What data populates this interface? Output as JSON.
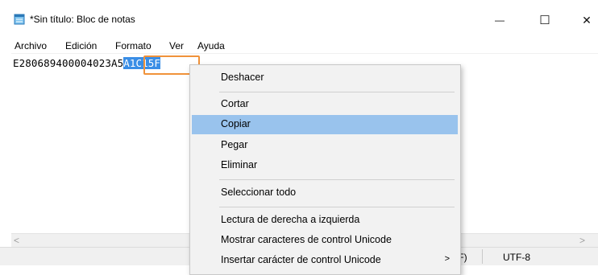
{
  "window": {
    "title": "*Sin título: Bloc de notas",
    "minimize_glyph": "—",
    "maximize_glyph": "☐",
    "close_glyph": "✕"
  },
  "menu": {
    "items": [
      "Archivo",
      "Edición",
      "Formato",
      "Ver",
      "Ayuda"
    ]
  },
  "editor": {
    "text_before": "E280689400004023A5",
    "selected_text": "A1C15F"
  },
  "scrollbar": {
    "left_arrow": "<",
    "right_arrow": ">"
  },
  "status": {
    "line_ending_partial": ".F)",
    "encoding": "UTF-8"
  },
  "context_menu": {
    "items": [
      "Deshacer",
      "Cortar",
      "Copiar",
      "Pegar",
      "Eliminar",
      "Seleccionar todo",
      "Lectura de derecha a izquierda",
      "Mostrar caracteres de control Unicode",
      "Insertar carácter de control Unicode"
    ],
    "highlighted": "Copiar",
    "submenu_arrow": ">"
  },
  "colors": {
    "selection": "#3a8ee6",
    "selection_outline": "#f0923a",
    "menu_highlight": "#99c3ed"
  }
}
